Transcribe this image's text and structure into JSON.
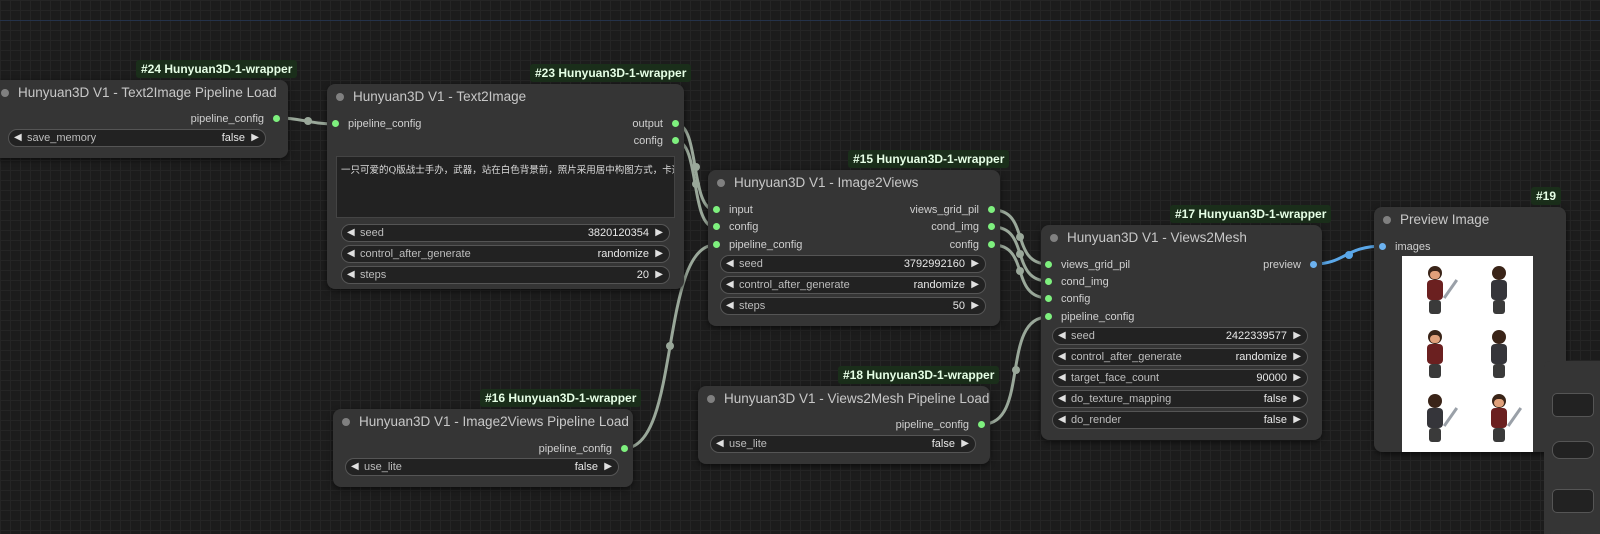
{
  "nodes": {
    "n24": {
      "badge": "#24 Hunyuan3D-1-wrapper",
      "title": "Hunyuan3D V1 - Text2Image Pipeline Load",
      "outputs": [
        "pipeline_config"
      ],
      "widgets": [
        {
          "label": "save_memory",
          "value": "false"
        }
      ]
    },
    "n23": {
      "badge": "#23 Hunyuan3D-1-wrapper",
      "title": "Hunyuan3D V1 - Text2Image",
      "inputs": [
        "pipeline_config"
      ],
      "outputs": [
        "output",
        "config"
      ],
      "prompt": "一只可爱的Q版战士手办，武器，站在白色背景前，照片采用居中构图方式，卡通风格",
      "widgets": [
        {
          "label": "seed",
          "value": "3820120354"
        },
        {
          "label": "control_after_generate",
          "value": "randomize"
        },
        {
          "label": "steps",
          "value": "20"
        }
      ]
    },
    "n15": {
      "badge": "#15 Hunyuan3D-1-wrapper",
      "title": "Hunyuan3D V1 - Image2Views",
      "inputs": [
        "input",
        "config",
        "pipeline_config"
      ],
      "outputs": [
        "views_grid_pil",
        "cond_img",
        "config"
      ],
      "widgets": [
        {
          "label": "seed",
          "value": "3792992160"
        },
        {
          "label": "control_after_generate",
          "value": "randomize"
        },
        {
          "label": "steps",
          "value": "50"
        }
      ]
    },
    "n17": {
      "badge": "#17 Hunyuan3D-1-wrapper",
      "title": "Hunyuan3D V1 - Views2Mesh",
      "inputs": [
        "views_grid_pil",
        "cond_img",
        "config",
        "pipeline_config"
      ],
      "outputs": [
        "preview"
      ],
      "widgets": [
        {
          "label": "seed",
          "value": "2422339577"
        },
        {
          "label": "control_after_generate",
          "value": "randomize"
        },
        {
          "label": "target_face_count",
          "value": "90000"
        },
        {
          "label": "do_texture_mapping",
          "value": "false"
        },
        {
          "label": "do_render",
          "value": "false"
        }
      ]
    },
    "n16": {
      "badge": "#16 Hunyuan3D-1-wrapper",
      "title": "Hunyuan3D V1 - Image2Views Pipeline Load",
      "outputs": [
        "pipeline_config"
      ],
      "widgets": [
        {
          "label": "use_lite",
          "value": "false"
        }
      ]
    },
    "n18": {
      "badge": "#18 Hunyuan3D-1-wrapper",
      "title": "Hunyuan3D V1 - Views2Mesh Pipeline Load",
      "outputs": [
        "pipeline_config"
      ],
      "widgets": [
        {
          "label": "use_lite",
          "value": "false"
        }
      ]
    },
    "n19": {
      "badge": "#19",
      "title": "Preview Image",
      "inputs": [
        "images"
      ]
    }
  },
  "colors": {
    "canvas": "#1c1c1c",
    "node": "#353535",
    "badge_bg": "#1a2e1a",
    "pin_green": "#7ef07e",
    "pin_blue": "#6cb2f0",
    "link_gray": "#9aa89a",
    "link_blue": "#5aa7e8"
  },
  "icons": {
    "status_dot": "gray-circle",
    "widget_left": "triangle-left",
    "widget_right": "triangle-right"
  }
}
